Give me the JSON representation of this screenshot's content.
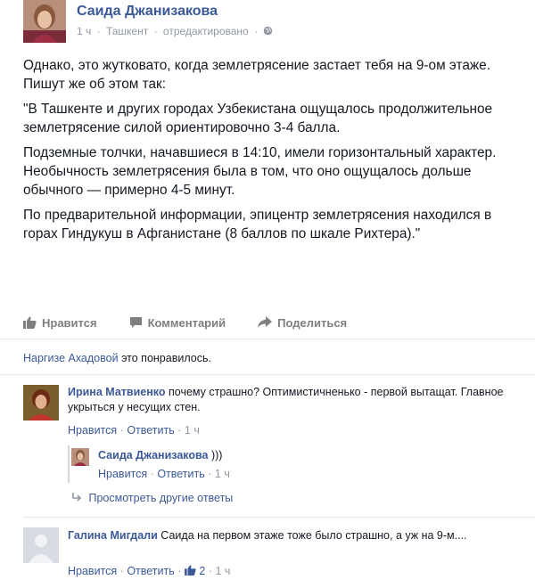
{
  "post": {
    "author": "Саида Джанизакова",
    "time": "1 ч",
    "location": "Ташкент",
    "edited": "отредактировано",
    "sep": "·",
    "paragraphs": [
      "Однако, это жутковато, когда землетрясение застает тебя на 9-ом этаже. Пишут же об этом так:",
      "\"В Ташкенте и других городах Узбекистана ощущалось продолжительное землетрясение силой ориентировочно 3-4 балла.",
      "Подземные толчки, начавшиеся в 14:10, имели горизонтальный характер. Необычность землетрясения была в том, что оно ощущалось дольше обычного — примерно 4-5 минут.",
      "По предварительной информации, эпицентр землетрясения находился в горах Гиндукуш в Афганистане (8 баллов по шкале Рихтера).\""
    ]
  },
  "actions": {
    "like": "Нравится",
    "comment": "Комментарий",
    "share": "Поделиться"
  },
  "likes_line": {
    "name": "Наргизе Ахадовой",
    "text": "это понравилось."
  },
  "comments": [
    {
      "name": "Ирина Матвиенко",
      "text": "почему страшно? Оптимистичненько - первой вытащат. Главное укрыться у несущих стен.",
      "like": "Нравится",
      "reply": "Ответить",
      "time": "1 ч"
    },
    {
      "name": "Саида Джанизакова",
      "text": ")))",
      "like": "Нравится",
      "reply": "Ответить",
      "time": "1 ч"
    },
    {
      "name": "Галина Мигдали",
      "text": "Саида на первом этаже тоже было страшно, а уж на 9-м....",
      "like": "Нравится",
      "reply": "Ответить",
      "likes_count": "2",
      "time": "1 ч"
    }
  ],
  "more_replies": "Просмотреть другие ответы",
  "sep": "·",
  "colors": {
    "link": "#3b5998",
    "meta": "#9197a3"
  }
}
